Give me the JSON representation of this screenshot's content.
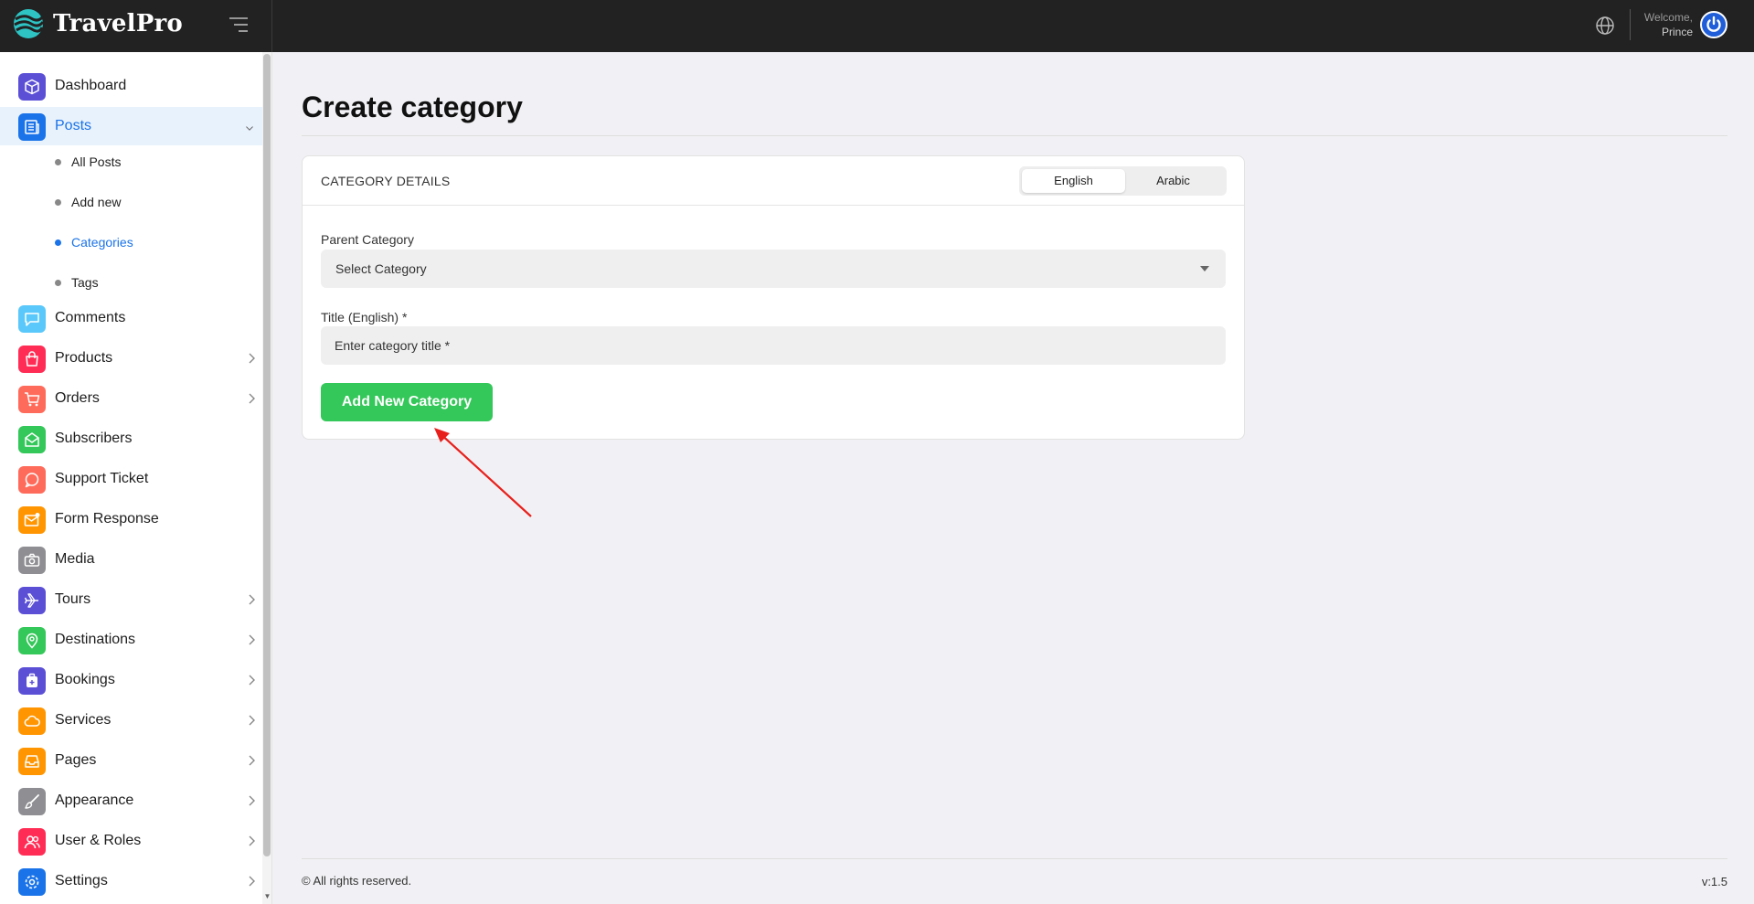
{
  "app": {
    "name": "TravelPro"
  },
  "header": {
    "welcome_label": "Welcome,",
    "user_name": "Prince"
  },
  "sidebar": {
    "items": [
      {
        "key": "dashboard",
        "label": "Dashboard",
        "icon": "cube-icon",
        "color": "#5b4fd6",
        "has_chevron": false
      },
      {
        "key": "posts",
        "label": "Posts",
        "icon": "newspaper-icon",
        "color": "#1a73e8",
        "has_chevron": true,
        "expanded": true,
        "active": true
      },
      {
        "key": "comments",
        "label": "Comments",
        "icon": "chat-bubble-icon",
        "color": "#5ac8fa",
        "has_chevron": false
      },
      {
        "key": "products",
        "label": "Products",
        "icon": "shopping-bag-icon",
        "color": "#ff2d55",
        "has_chevron": true
      },
      {
        "key": "orders",
        "label": "Orders",
        "icon": "cart-icon",
        "color": "#ff6b5b",
        "has_chevron": true
      },
      {
        "key": "subscribers",
        "label": "Subscribers",
        "icon": "mail-open-icon",
        "color": "#34c759",
        "has_chevron": false
      },
      {
        "key": "support-ticket",
        "label": "Support Ticket",
        "icon": "support-chat-icon",
        "color": "#ff6b5b",
        "has_chevron": false
      },
      {
        "key": "form-response",
        "label": "Form Response",
        "icon": "mail-notify-icon",
        "color": "#ff9500",
        "has_chevron": false
      },
      {
        "key": "media",
        "label": "Media",
        "icon": "camera-icon",
        "color": "#8e8e93",
        "has_chevron": false
      },
      {
        "key": "tours",
        "label": "Tours",
        "icon": "airplane-icon",
        "color": "#5b4fd6",
        "has_chevron": true
      },
      {
        "key": "destinations",
        "label": "Destinations",
        "icon": "map-pin-icon",
        "color": "#34c759",
        "has_chevron": true
      },
      {
        "key": "bookings",
        "label": "Bookings",
        "icon": "luggage-icon",
        "color": "#5b4fd6",
        "has_chevron": true
      },
      {
        "key": "services",
        "label": "Services",
        "icon": "cloud-icon",
        "color": "#ff9500",
        "has_chevron": true
      },
      {
        "key": "pages",
        "label": "Pages",
        "icon": "inbox-tray-icon",
        "color": "#ff9500",
        "has_chevron": true
      },
      {
        "key": "appearance",
        "label": "Appearance",
        "icon": "brush-icon",
        "color": "#8e8e93",
        "has_chevron": true
      },
      {
        "key": "user-roles",
        "label": "User & Roles",
        "icon": "users-icon",
        "color": "#ff2d55",
        "has_chevron": true
      },
      {
        "key": "settings",
        "label": "Settings",
        "icon": "gear-icon",
        "color": "#1a73e8",
        "has_chevron": true
      }
    ],
    "posts_sub": [
      {
        "label": "All Posts",
        "current": false
      },
      {
        "label": "Add new",
        "current": false
      },
      {
        "label": "Categories",
        "current": true
      },
      {
        "label": "Tags",
        "current": false
      }
    ]
  },
  "main": {
    "page_title": "Create category",
    "card": {
      "heading": "CATEGORY DETAILS",
      "languages": [
        "English",
        "Arabic"
      ],
      "selected_language": "English",
      "parent_label": "Parent Category",
      "parent_value": "Select Category",
      "title_label": "Title (English) *",
      "title_placeholder": "Enter category title *",
      "submit_label": "Add New Category"
    }
  },
  "footer": {
    "copyright": "© All rights reserved.",
    "version": "v:1.5"
  },
  "colors": {
    "topbar": "#222222",
    "accent": "#1a73e8",
    "submit": "#34c759",
    "annotation": "#e8201c"
  }
}
